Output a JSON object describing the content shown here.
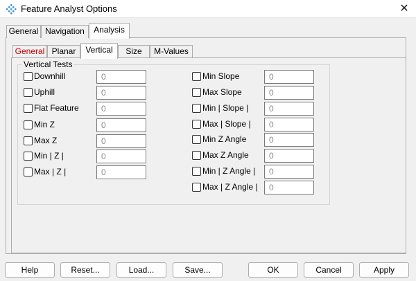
{
  "window": {
    "title": "Feature Analyst Options",
    "close_glyph": "✕"
  },
  "outer_tabs": [
    {
      "label": "General"
    },
    {
      "label": "Navigation"
    },
    {
      "label": "Analysis",
      "active": true
    }
  ],
  "inner_tabs": [
    {
      "label": "General",
      "color": "#c00000"
    },
    {
      "label": "Planar"
    },
    {
      "label": "Vertical",
      "active": true
    },
    {
      "label": "Size"
    },
    {
      "label": "M-Values"
    }
  ],
  "group": {
    "label": "Vertical Tests",
    "left_tests": [
      {
        "label": "Downhill",
        "value": "0"
      },
      {
        "label": "Uphill",
        "value": "0"
      },
      {
        "label": "Flat Feature",
        "value": "0"
      },
      {
        "label": "Min Z",
        "value": "0"
      },
      {
        "label": "Max Z",
        "value": "0"
      },
      {
        "label": "Min | Z |",
        "value": "0"
      },
      {
        "label": "Max | Z |",
        "value": "0"
      }
    ],
    "right_tests": [
      {
        "label": "Min Slope",
        "value": "0"
      },
      {
        "label": "Max Slope",
        "value": "0"
      },
      {
        "label": "Min | Slope |",
        "value": "0"
      },
      {
        "label": "Max | Slope |",
        "value": "0"
      },
      {
        "label": "Min Z Angle",
        "value": "0"
      },
      {
        "label": "Max Z Angle",
        "value": "0"
      },
      {
        "label": "Min | Z Angle |",
        "value": "0"
      },
      {
        "label": "Max | Z Angle |",
        "value": "0"
      }
    ]
  },
  "buttons": {
    "help": "Help",
    "reset": "Reset...",
    "load": "Load...",
    "save": "Save...",
    "ok": "OK",
    "cancel": "Cancel",
    "apply": "Apply"
  }
}
